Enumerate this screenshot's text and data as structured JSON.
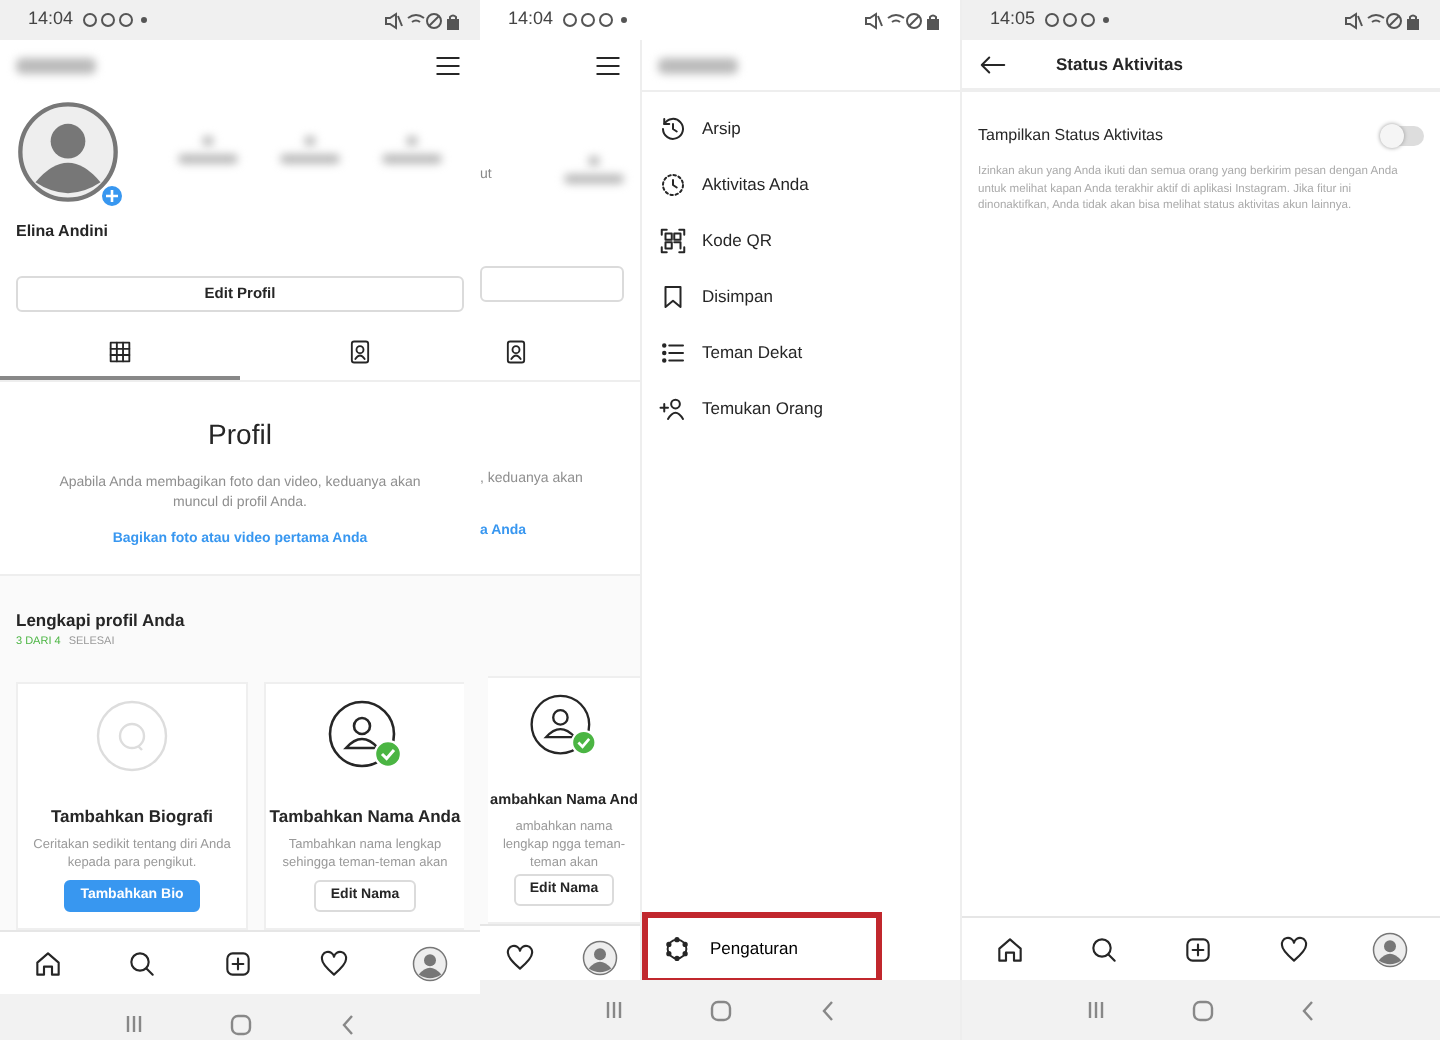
{
  "profile_screen": {
    "status_bar": {
      "time": "14:04"
    },
    "display_name": "Elina Andini",
    "edit_button": "Edit Profil",
    "tabs": [
      {
        "kind": "grid",
        "selected": true
      },
      {
        "kind": "tagged",
        "selected": false
      }
    ],
    "empty_state": {
      "title": "Profil",
      "text": "Apabila Anda membagikan foto dan video, keduanya akan muncul di profil Anda.",
      "link": "Bagikan foto atau video pertama Anda"
    },
    "complete_profile": {
      "title": "Lengkapi profil Anda",
      "progress_done": "3 DARI 4",
      "progress_label": "SELESAI",
      "cards": [
        {
          "kind": "bio",
          "title": "Tambahkan Biografi",
          "text": "Ceritakan sedikit tentang diri Anda kepada para pengikut.",
          "button": "Tambahkan Bio",
          "primary": true
        },
        {
          "kind": "name",
          "title": "Tambahkan Nama Anda",
          "text": "Tambahkan nama lengkap sehingga teman-teman akan",
          "button": "Edit Nama",
          "primary": false,
          "done": true
        }
      ]
    },
    "bottom_nav": [
      {
        "kind": "home"
      },
      {
        "kind": "search"
      },
      {
        "kind": "add"
      },
      {
        "kind": "activity"
      },
      {
        "kind": "profile"
      }
    ]
  },
  "menu_screen": {
    "status_bar": {
      "time": "14:04"
    },
    "behind": {
      "stat_fragment": "ut",
      "text_fragment": ", keduanya akan",
      "link_fragment": "a Anda",
      "card": {
        "title": "ambahkan Nama And",
        "text": "ambahkan nama lengkap ngga teman-teman akan",
        "button": "Edit Nama",
        "done": true
      },
      "bottom_nav": [
        {
          "kind": "activity"
        },
        {
          "kind": "profile"
        }
      ]
    },
    "menu_items": [
      {
        "kind": "archive",
        "label": "Arsip"
      },
      {
        "kind": "activity",
        "label": "Aktivitas Anda"
      },
      {
        "kind": "qr",
        "label": "Kode QR"
      },
      {
        "kind": "saved",
        "label": "Disimpan"
      },
      {
        "kind": "close_friends",
        "label": "Teman Dekat"
      },
      {
        "kind": "discover",
        "label": "Temukan Orang"
      }
    ],
    "settings_item": {
      "label": "Pengaturan",
      "highlighted": true
    }
  },
  "settings_screen": {
    "status_bar": {
      "time": "14:05"
    },
    "title": "Status Aktivitas",
    "setting": {
      "label": "Tampilkan Status Aktivitas",
      "on": false,
      "description": "Izinkan akun yang Anda ikuti dan semua orang yang berkirim pesan dengan Anda untuk melihat kapan Anda terakhir aktif di aplikasi Instagram. Jika fitur ini dinonaktifkan, Anda tidak akan bisa melihat status aktivitas akun lainnya."
    },
    "bottom_nav": [
      {
        "kind": "home"
      },
      {
        "kind": "search"
      },
      {
        "kind": "add"
      },
      {
        "kind": "activity"
      },
      {
        "kind": "profile"
      }
    ]
  }
}
